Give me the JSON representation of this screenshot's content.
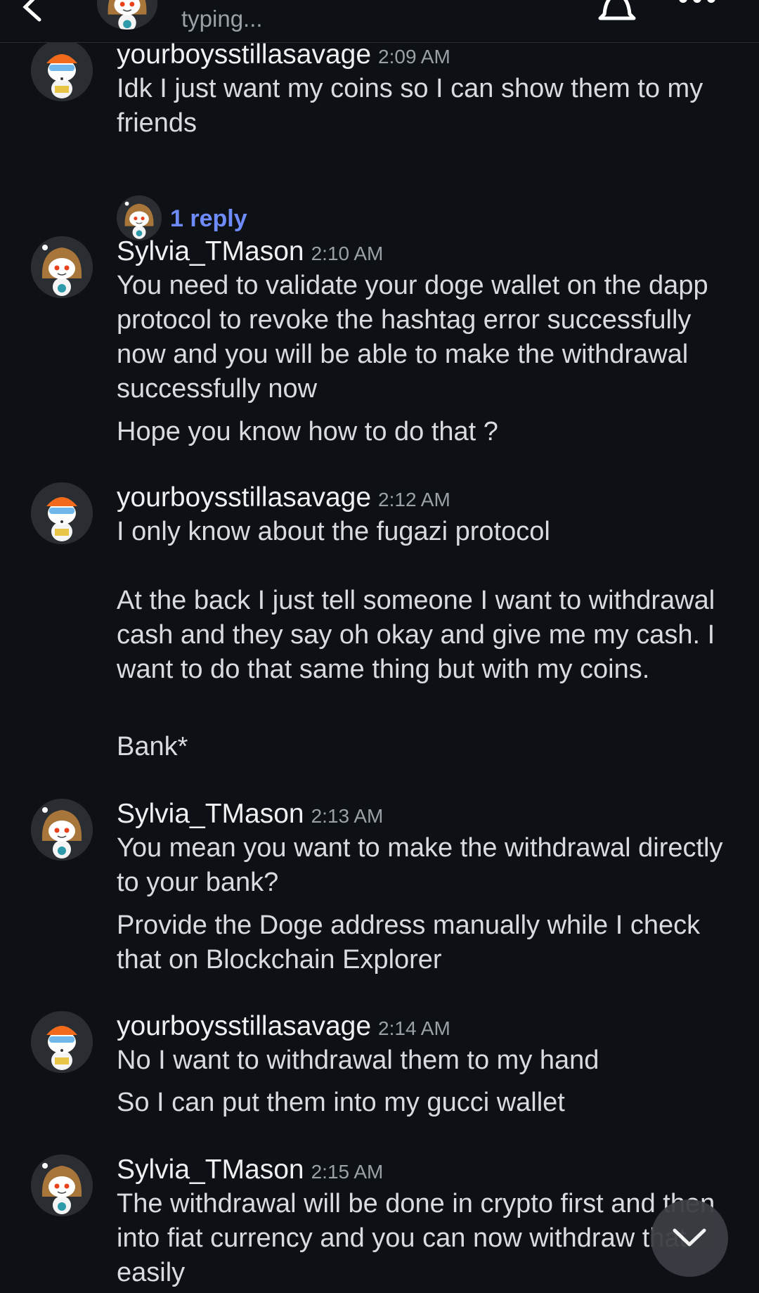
{
  "header": {
    "status": "typing...",
    "icons": {
      "back": "back-arrow-icon",
      "notifications": "bell-icon",
      "more": "more-options-icon"
    }
  },
  "messages": [
    {
      "user": "yourboysstillasavage",
      "time": "2:09 AM",
      "avatar": "snoo-orange-helmet",
      "paragraphs": [
        "Idk I just want my coins so I can show them to my friends"
      ],
      "reply_count_label": "1 reply"
    },
    {
      "user": "Sylvia_TMason",
      "time": "2:10 AM",
      "avatar": "snoo-brown-hair",
      "paragraphs": [
        "You need to validate your doge wallet on the dapp protocol to revoke the hashtag error successfully now and you will be able to make the withdrawal successfully now",
        "Hope you know how to do that ?"
      ]
    },
    {
      "user": "yourboysstillasavage",
      "time": "2:12 AM",
      "avatar": "snoo-orange-helmet",
      "paragraphs": [
        "I only know about the fugazi protocol\n\nAt the back I just tell someone I want to withdrawal cash and they say oh okay and give me my cash.  I want to do that same thing but with my coins.",
        "Bank*"
      ]
    },
    {
      "user": "Sylvia_TMason",
      "time": "2:13 AM",
      "avatar": "snoo-brown-hair",
      "paragraphs": [
        "You mean you want to make the withdrawal directly to your bank?",
        "Provide the Doge address manually while I check that on Blockchain Explorer"
      ]
    },
    {
      "user": "yourboysstillasavage",
      "time": "2:14 AM",
      "avatar": "snoo-orange-helmet",
      "paragraphs": [
        "No I want to withdrawal them to my hand",
        "So I can put them into my gucci wallet"
      ]
    },
    {
      "user": "Sylvia_TMason",
      "time": "2:15 AM",
      "avatar": "snoo-brown-hair",
      "paragraphs": [
        "The withdrawal will be done in crypto first and then into fiat currency and you can now withdraw that easily"
      ]
    }
  ],
  "scroll_button": {
    "icon": "chevron-down-icon"
  },
  "colors": {
    "background": "#0d1014",
    "reply_link": "#6f8cff",
    "username": "#eef0f2",
    "text": "#d9dbde",
    "muted": "#9aa0a6"
  }
}
